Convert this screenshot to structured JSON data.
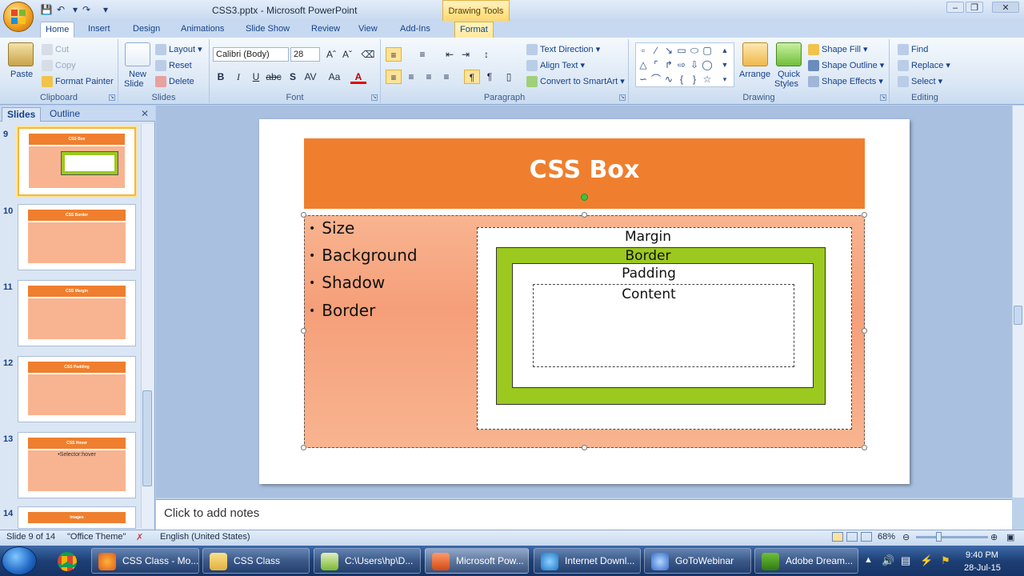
{
  "window": {
    "title": "CSS3.pptx - Microsoft PowerPoint",
    "contextual_tab_group": "Drawing Tools"
  },
  "tabs": [
    "Home",
    "Insert",
    "Design",
    "Animations",
    "Slide Show",
    "Review",
    "View",
    "Add-Ins",
    "Format"
  ],
  "ribbon": {
    "clipboard": {
      "label": "Clipboard",
      "paste": "Paste",
      "cut": "Cut",
      "copy": "Copy",
      "format_painter": "Format Painter"
    },
    "slides": {
      "label": "Slides",
      "new_slide": "New",
      "new_slide2": "Slide",
      "layout": "Layout",
      "reset": "Reset",
      "delete": "Delete"
    },
    "font": {
      "label": "Font",
      "family": "Calibri (Body)",
      "size": "28"
    },
    "paragraph": {
      "label": "Paragraph",
      "text_direction": "Text Direction",
      "align_text": "Align Text",
      "convert_smartart": "Convert to SmartArt"
    },
    "drawing": {
      "label": "Drawing",
      "arrange": "Arrange",
      "quick_styles": "Quick",
      "quick_styles2": "Styles",
      "shape_fill": "Shape Fill",
      "shape_outline": "Shape Outline",
      "shape_effects": "Shape Effects"
    },
    "editing": {
      "label": "Editing",
      "find": "Find",
      "replace": "Replace",
      "select": "Select"
    }
  },
  "pane": {
    "tab_slides": "Slides",
    "tab_outline": "Outline",
    "thumbnails": [
      {
        "num": "9",
        "title": "CSS Box",
        "body": ""
      },
      {
        "num": "10",
        "title": "CSS Border",
        "body": ""
      },
      {
        "num": "11",
        "title": "CSS Margin",
        "body": ""
      },
      {
        "num": "12",
        "title": "CSS Padding",
        "body": ""
      },
      {
        "num": "13",
        "title": "CSS Hover",
        "body": "•Selector:hover"
      },
      {
        "num": "14",
        "title": "Images",
        "body": ""
      }
    ]
  },
  "slide": {
    "title": "CSS Box",
    "bullets": [
      "Size",
      "Background",
      "Shadow",
      "Border"
    ],
    "diagram": {
      "margin": "Margin",
      "border": "Border",
      "padding": "Padding",
      "content": "Content"
    }
  },
  "notes_placeholder": "Click to add notes",
  "status": {
    "slide_count": "Slide 9 of 14",
    "theme": "\"Office Theme\"",
    "language": "English (United States)",
    "zoom": "68%"
  },
  "taskbar": {
    "items": [
      "CSS Class - Mo...",
      "CSS Class",
      "C:\\Users\\hp\\D...",
      "Microsoft Pow...",
      "Internet Downl...",
      "GoToWebinar",
      "Adobe Dream..."
    ],
    "time": "9:40 PM",
    "date": "28-Jul-15"
  },
  "colors": {
    "slide_title_bar": "#ef7f2e",
    "content_fill": "#f8b490",
    "border_green": "#9cc91f",
    "ribbon_bg": "#dbe7f5"
  }
}
